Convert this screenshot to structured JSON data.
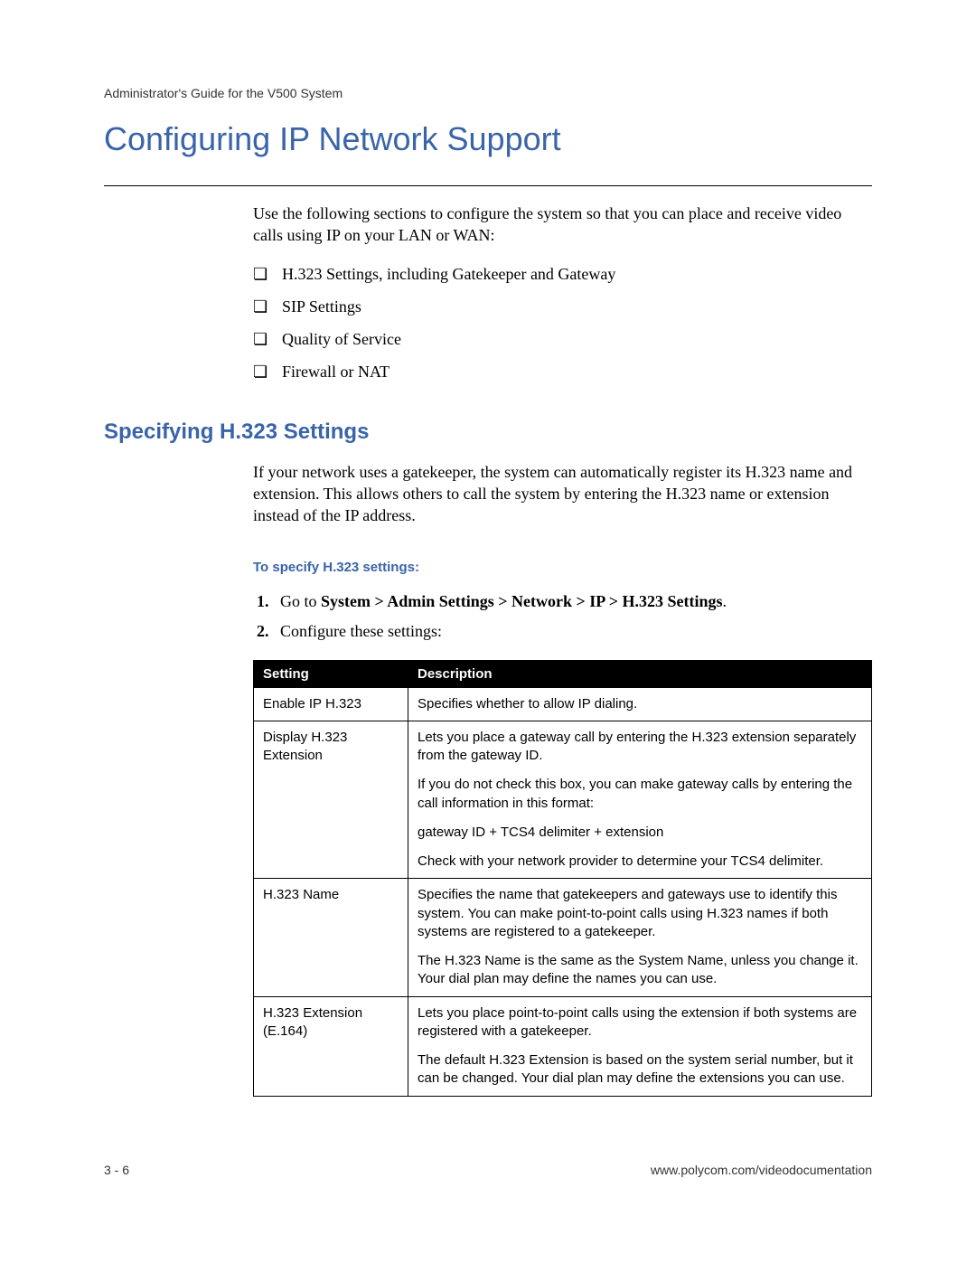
{
  "header": "Administrator's Guide for the V500 System",
  "title": "Configuring IP Network Support",
  "intro": "Use the following sections to configure the system so that you can place and receive video calls using IP on your LAN or WAN:",
  "bullets": [
    "H.323 Settings, including Gatekeeper and Gateway",
    "SIP Settings",
    "Quality of Service",
    "Firewall or NAT"
  ],
  "section": {
    "title": "Specifying H.323 Settings",
    "body": "If your network uses a gatekeeper, the system can automatically register its H.323 name and extension. This allows others to call the system by entering the H.323 name or extension instead of the IP address.",
    "procedure_label": "To specify H.323 settings:",
    "steps": {
      "s1_pre": "Go to ",
      "s1_bold": "System > Admin Settings > Network > IP > H.323 Settings",
      "s1_post": ".",
      "s2": "Configure these settings:"
    }
  },
  "table": {
    "headers": {
      "col1": "Setting",
      "col2": "Description"
    },
    "rows": [
      {
        "setting": "Enable IP H.323",
        "desc": [
          "Specifies whether to allow IP dialing."
        ]
      },
      {
        "setting": "Display H.323 Extension",
        "desc": [
          "Lets you place a gateway call by entering the H.323 extension separately from the gateway ID.",
          "If you do not check this box, you can make gateway calls by entering the call information in this format:",
          "gateway ID + TCS4 delimiter + extension",
          "Check with your network provider to determine your TCS4 delimiter."
        ]
      },
      {
        "setting": "H.323 Name",
        "desc": [
          "Specifies the name that gatekeepers and gateways use to identify this system. You can make point-to-point calls using H.323 names if both systems are registered to a gatekeeper.",
          "The H.323 Name is the same as the System Name, unless you change it. Your dial plan may define the names you can use."
        ]
      },
      {
        "setting": "H.323 Extension (E.164)",
        "desc": [
          "Lets you place point-to-point calls using the extension if both systems are registered with a gatekeeper.",
          "The default H.323 Extension is based on the system serial number, but it can be changed. Your dial plan may define the extensions you can use."
        ]
      }
    ]
  },
  "footer": {
    "left": "3 - 6",
    "right": "www.polycom.com/videodocumentation"
  }
}
